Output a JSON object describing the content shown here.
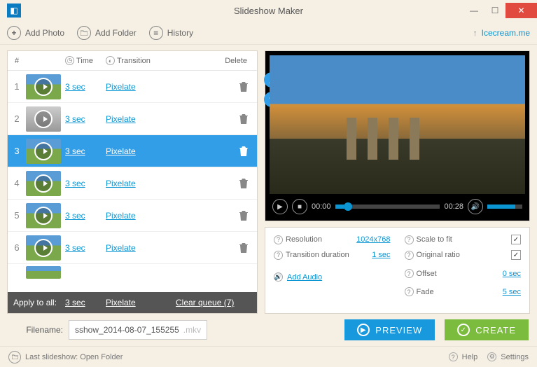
{
  "window": {
    "title": "Slideshow Maker"
  },
  "toolbar": {
    "add_photo": "Add Photo",
    "add_folder": "Add Folder",
    "history": "History",
    "brand": "Icecream.me"
  },
  "table": {
    "headers": {
      "num": "#",
      "time": "Time",
      "transition": "Transition",
      "delete": "Delete"
    },
    "rows": [
      {
        "num": "1",
        "time": "3 sec",
        "transition": "Pixelate",
        "selected": false,
        "thumb": "color"
      },
      {
        "num": "2",
        "time": "3 sec",
        "transition": "Pixelate",
        "selected": false,
        "thumb": "gray"
      },
      {
        "num": "3",
        "time": "3 sec",
        "transition": "Pixelate",
        "selected": true,
        "thumb": "color"
      },
      {
        "num": "4",
        "time": "3 sec",
        "transition": "Pixelate",
        "selected": false,
        "thumb": "color"
      },
      {
        "num": "5",
        "time": "3 sec",
        "transition": "Pixelate",
        "selected": false,
        "thumb": "color"
      },
      {
        "num": "6",
        "time": "3 sec",
        "transition": "Pixelate",
        "selected": false,
        "thumb": "color"
      }
    ],
    "apply_all": {
      "label": "Apply to all:",
      "time": "3 sec",
      "transition": "Pixelate",
      "clear": "Clear queue (7)"
    }
  },
  "playback": {
    "current": "00:00",
    "total": "00:28"
  },
  "settings": {
    "resolution_label": "Resolution",
    "resolution_value": "1024x768",
    "transdur_label": "Transition duration",
    "transdur_value": "1 sec",
    "scale_label": "Scale to fit",
    "scale_checked": "✓",
    "ratio_label": "Original ratio",
    "ratio_checked": "✓",
    "offset_label": "Offset",
    "offset_value": "0 sec",
    "fade_label": "Fade",
    "fade_value": "5 sec",
    "add_audio": "Add Audio"
  },
  "filename": {
    "label": "Filename:",
    "value": "sshow_2014-08-07_155255",
    "ext": ".mkv"
  },
  "buttons": {
    "preview": "PREVIEW",
    "create": "CREATE"
  },
  "footer": {
    "last": "Last slideshow: Open Folder",
    "help": "Help",
    "settings": "Settings"
  }
}
